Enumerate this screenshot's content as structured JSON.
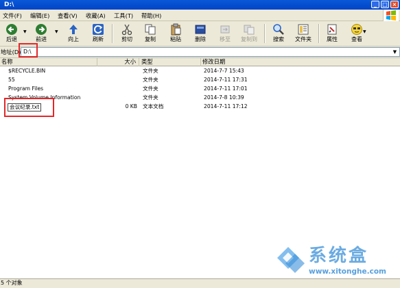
{
  "window": {
    "title": "D:\\"
  },
  "menu": {
    "items": [
      {
        "label": "文件(F)"
      },
      {
        "label": "编辑(E)"
      },
      {
        "label": "查看(V)"
      },
      {
        "label": "收藏(A)"
      },
      {
        "label": "工具(T)"
      },
      {
        "label": "帮助(H)"
      }
    ]
  },
  "toolbar": {
    "buttons": [
      {
        "label": "后退",
        "icon": "back-arrow-icon",
        "enabled": true
      },
      {
        "label": "前进",
        "icon": "forward-arrow-icon",
        "enabled": true
      },
      {
        "label": "向上",
        "icon": "up-arrow-icon",
        "enabled": true
      },
      {
        "label": "刷新",
        "icon": "refresh-icon",
        "enabled": true
      },
      {
        "label": "剪切",
        "icon": "scissors-icon",
        "enabled": true
      },
      {
        "label": "复制",
        "icon": "copy-icon",
        "enabled": true
      },
      {
        "label": "粘贴",
        "icon": "paste-icon",
        "enabled": true
      },
      {
        "label": "删除",
        "icon": "delete-icon",
        "enabled": true
      },
      {
        "label": "移至",
        "icon": "move-to-icon",
        "enabled": false
      },
      {
        "label": "复制到",
        "icon": "copy-to-icon",
        "enabled": false
      },
      {
        "label": "搜索",
        "icon": "search-icon",
        "enabled": true
      },
      {
        "label": "文件夹",
        "icon": "folder-icon",
        "enabled": true
      },
      {
        "label": "属性",
        "icon": "properties-icon",
        "enabled": true
      },
      {
        "label": "查看",
        "icon": "view-icon",
        "enabled": true
      }
    ]
  },
  "address": {
    "label": "地址(D)",
    "value": "D:\\"
  },
  "columns": {
    "name": "名称",
    "size": "大小",
    "type": "类型",
    "modified": "修改日期"
  },
  "files": [
    {
      "name": "$RECYCLE.BIN",
      "size": "",
      "type": "文件夹",
      "modified": "2014-7-7 15:43"
    },
    {
      "name": "55",
      "size": "",
      "type": "文件夹",
      "modified": "2014-7-11 17:31"
    },
    {
      "name": "Program Files",
      "size": "",
      "type": "文件夹",
      "modified": "2014-7-11 17:01"
    },
    {
      "name": "System Volume Information",
      "size": "",
      "type": "文件夹",
      "modified": "2014-7-8 10:39"
    },
    {
      "name": "会议纪录.txt",
      "size": "0 KB",
      "type": "文本文档",
      "modified": "2014-7-11 17:12"
    }
  ],
  "status": {
    "text": "5 个对象"
  },
  "watermark": {
    "brand": "系统盒",
    "url": "www.xitonghe.com"
  },
  "colors": {
    "titlebar": "#0a58d8",
    "highlight_box": "#e3262a",
    "watermark": "#3a8fd8"
  }
}
